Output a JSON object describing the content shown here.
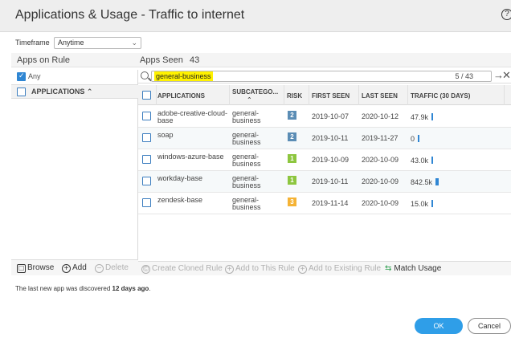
{
  "dialog": {
    "title": "Applications & Usage - Traffic to internet",
    "help_icon": "question-circle-icon",
    "help_glyph": "?"
  },
  "timeframe": {
    "label": "Timeframe",
    "value": "Anytime"
  },
  "apps_on_rule": {
    "heading": "Apps on Rule",
    "any_label": "Any",
    "any_checked": true,
    "column_header": "APPLICATIONS",
    "footer": {
      "browse": "Browse",
      "add": "Add",
      "delete": "Delete"
    }
  },
  "apps_seen": {
    "heading": "Apps Seen",
    "count": "43",
    "search_value": "general-business",
    "match_count": "5 / 43",
    "columns": [
      "APPLICATIONS",
      "SUBCATEGO...",
      "RISK",
      "FIRST SEEN",
      "LAST SEEN",
      "TRAFFIC (30 DAYS)"
    ],
    "rows": [
      {
        "app": "adobe-creative-cloud-base",
        "subcategory": "general-business",
        "risk": "2",
        "risk_color": "#5b8db5",
        "first_seen": "2019-10-07",
        "last_seen": "2020-10-12",
        "traffic": "47.9k",
        "traffic_level": 0.3
      },
      {
        "app": "soap",
        "subcategory": "general-business",
        "risk": "2",
        "risk_color": "#5b8db5",
        "first_seen": "2019-10-11",
        "last_seen": "2019-11-27",
        "traffic": "0",
        "traffic_level": 0.3
      },
      {
        "app": "windows-azure-base",
        "subcategory": "general-business",
        "risk": "1",
        "risk_color": "#8dc63f",
        "first_seen": "2019-10-09",
        "last_seen": "2020-10-09",
        "traffic": "43.0k",
        "traffic_level": 0.3
      },
      {
        "app": "workday-base",
        "subcategory": "general-business",
        "risk": "1",
        "risk_color": "#8dc63f",
        "first_seen": "2019-10-11",
        "last_seen": "2020-10-09",
        "traffic": "842.5k",
        "traffic_level": 0.6
      },
      {
        "app": "zendesk-base",
        "subcategory": "general-business",
        "risk": "3",
        "risk_color": "#f5b335",
        "first_seen": "2019-11-14",
        "last_seen": "2020-10-09",
        "traffic": "15.0k",
        "traffic_level": 0.3
      }
    ],
    "actions": {
      "create_cloned_rule": "Create Cloned Rule",
      "add_to_this_rule": "Add to This Rule",
      "add_to_existing_rule": "Add to Existing Rule",
      "match_usage": "Match Usage"
    }
  },
  "footer_note": {
    "prefix": "The last new app was discovered ",
    "emphasis": "12 days ago",
    "suffix": "."
  },
  "buttons": {
    "ok": "OK",
    "cancel": "Cancel"
  },
  "colors": {
    "accent": "#2f9ee8",
    "search_highlight": "#fff200"
  }
}
